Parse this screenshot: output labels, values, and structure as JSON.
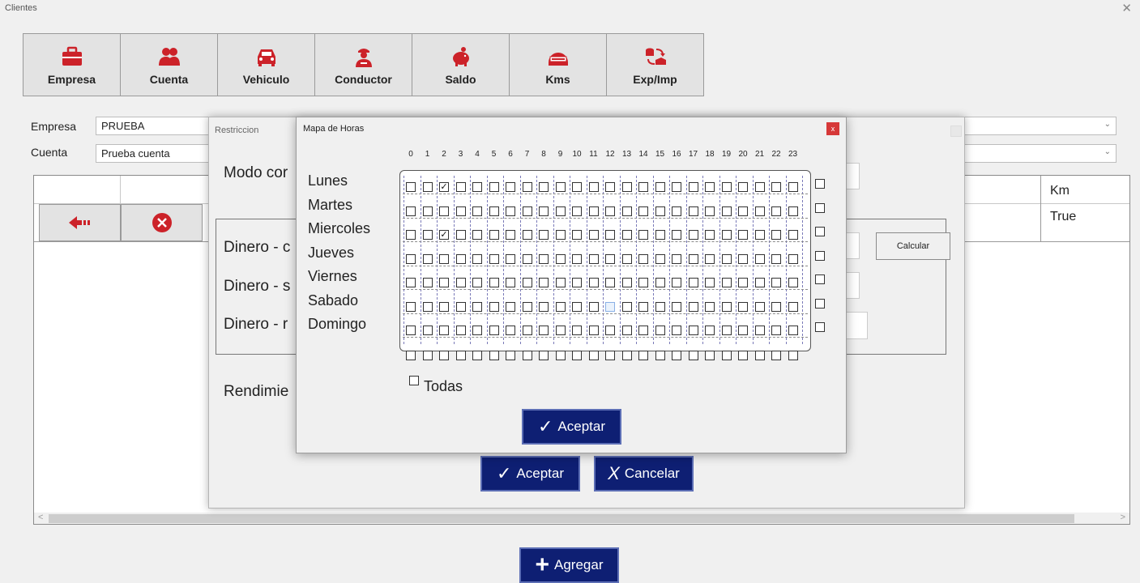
{
  "window": {
    "title": "Clientes",
    "close_glyph": "✕"
  },
  "toolbar": [
    {
      "label": "Empresa",
      "icon": "briefcase-icon"
    },
    {
      "label": "Cuenta",
      "icon": "users-icon"
    },
    {
      "label": "Vehiculo",
      "icon": "car-icon"
    },
    {
      "label": "Conductor",
      "icon": "driver-icon"
    },
    {
      "label": "Saldo",
      "icon": "piggy-bank-icon"
    },
    {
      "label": "Kms",
      "icon": "odometer-icon"
    },
    {
      "label": "Exp/Imp",
      "icon": "transfer-icon"
    }
  ],
  "filters": {
    "empresa_label": "Empresa",
    "empresa_value": "PRUEBA",
    "cuenta_label": "Cuenta",
    "cuenta_value": "Prueba cuenta",
    "arrow": "⌄"
  },
  "grid": {
    "col_header": "Km",
    "cell_value": "True",
    "scroll_left": "<",
    "scroll_right": ">"
  },
  "accent_colors": {
    "red": "#cc2229",
    "navy": "#0e1f73"
  },
  "restriccion": {
    "title": "Restriccion",
    "modo_label": "Modo cor",
    "dinero1": "Dinero - c",
    "dinero2": "Dinero - s",
    "dinero3": "Dinero - r",
    "rendimiento": "Rendimie",
    "calcular": "Calcular",
    "aceptar": "Aceptar",
    "cancelar": "Cancelar",
    "check_glyph": "✓",
    "x_glyph": "X"
  },
  "mapa": {
    "title": "Mapa de Horas",
    "close": "x",
    "hours": [
      "0",
      "1",
      "2",
      "3",
      "4",
      "5",
      "6",
      "7",
      "8",
      "9",
      "10",
      "11",
      "12",
      "13",
      "14",
      "15",
      "16",
      "17",
      "18",
      "19",
      "20",
      "21",
      "22",
      "23"
    ],
    "days": [
      "Lunes",
      "Martes",
      "Miercoles",
      "Jueves",
      "Viernes",
      "Sabado",
      "Domingo"
    ],
    "checked": [
      [
        0,
        2
      ],
      [
        2,
        2
      ]
    ],
    "todas": "Todas",
    "aceptar": "Aceptar"
  },
  "agregar": {
    "label": "Agregar",
    "plus": "+"
  }
}
